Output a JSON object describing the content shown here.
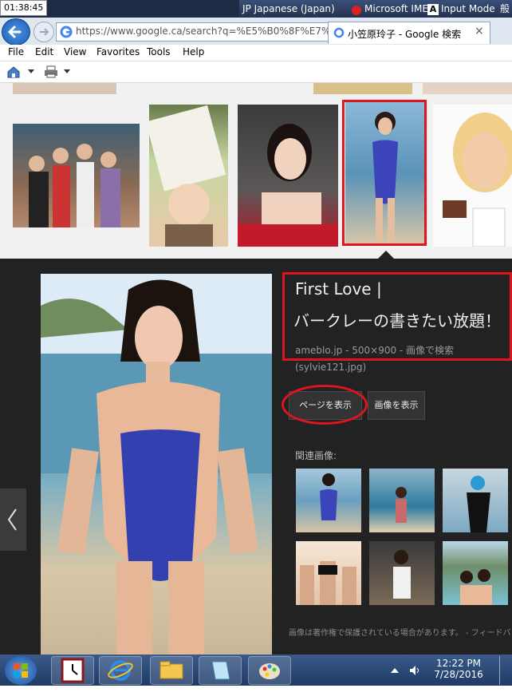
{
  "system": {
    "clock": "01:38:45",
    "language": "JP Japanese (Japan)",
    "ime": "Microsoft IME",
    "input_mode": "Input Mode",
    "truncated_char": "般"
  },
  "browser": {
    "url": "https://www.google.ca/search?q=%E5%B0%8F%E7%AC%A",
    "tab_title": "小笠原玲子 - Google 検索",
    "tab_close": "×",
    "menu": [
      "File",
      "Edit",
      "View",
      "Favorites",
      "Tools",
      "Help"
    ]
  },
  "detail": {
    "title_line1": "First Love |",
    "title_line2": "バークレーの書きたい放題！",
    "meta": "ameblo.jp - 500×900 - 画像で検索",
    "filename": "(sylvie121.jpg)",
    "visit_button": "ページを表示",
    "view_button": "画像を表示",
    "related_label": "関連画像:",
    "disclaimer": "画像は著作権で保護されている場合があります。 - フィードバ"
  },
  "taskbar": {
    "time": "12:22 PM",
    "date": "7/28/2016"
  },
  "colors": {
    "highlight": "#e0141e",
    "panel": "#222222",
    "taskbar": "#1f3a66"
  }
}
